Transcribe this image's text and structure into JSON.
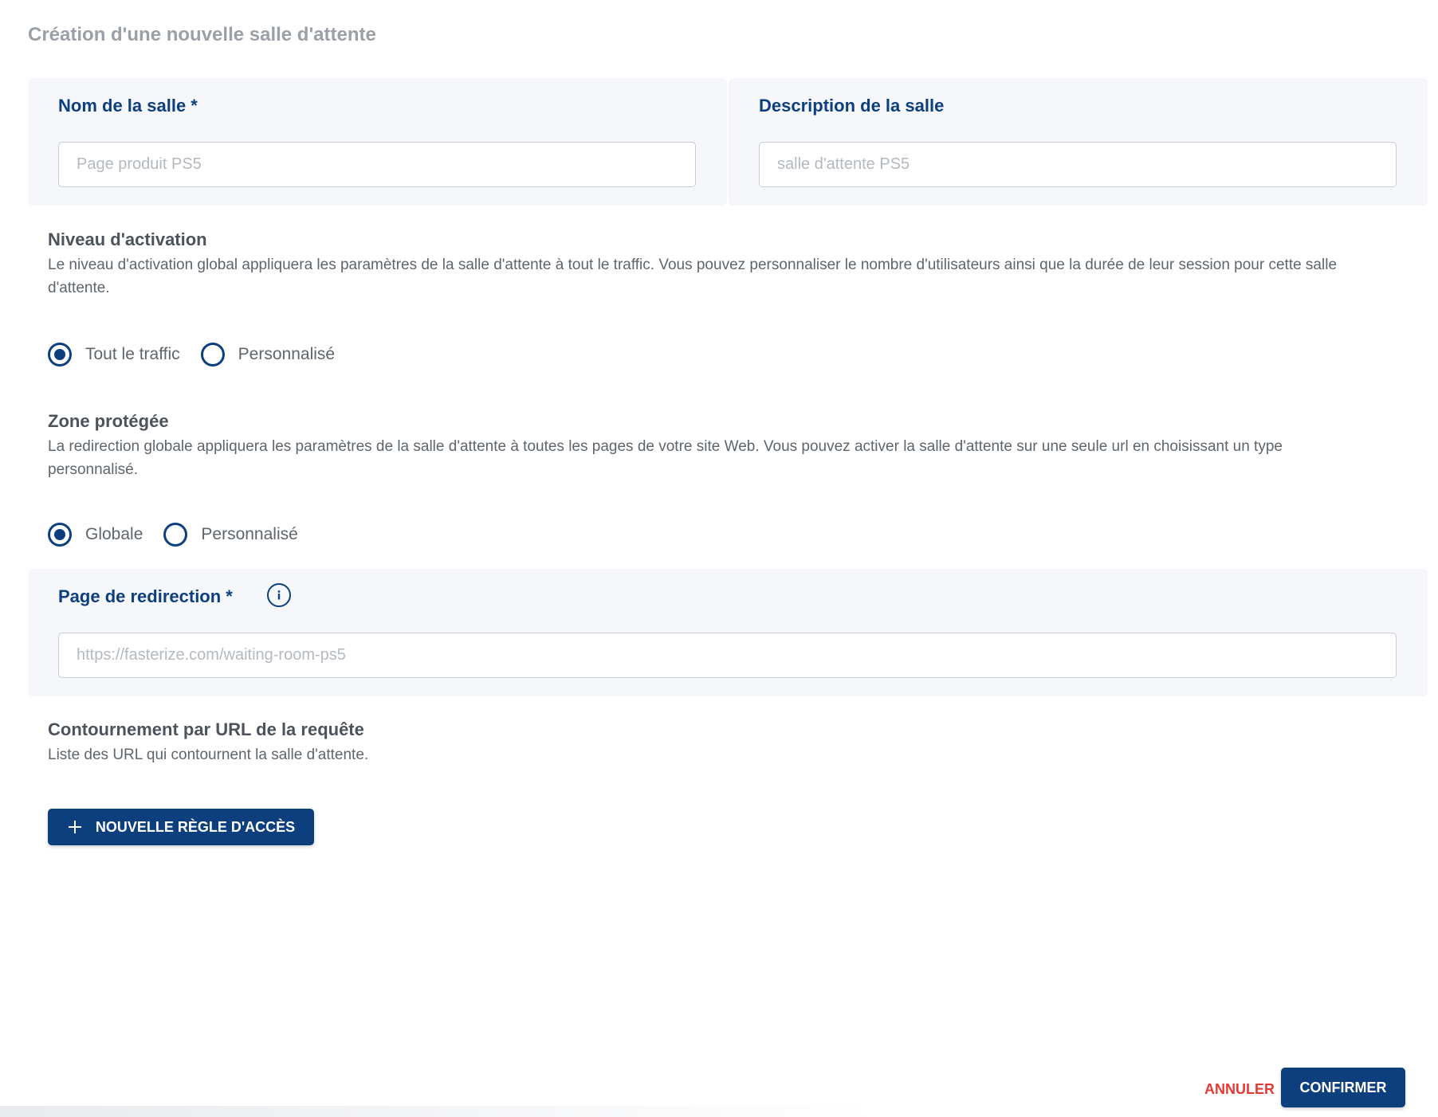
{
  "page": {
    "title": "Création d'une nouvelle salle d'attente"
  },
  "room_name": {
    "label": "Nom de la salle",
    "required_mark": "*",
    "placeholder": "Page produit PS5",
    "value": ""
  },
  "room_description": {
    "label": "Description de la salle",
    "placeholder": "salle d'attente PS5",
    "value": ""
  },
  "activation_level": {
    "title": "Niveau d'activation",
    "description": "Le niveau d'activation global appliquera les paramètres de la salle d'attente à tout le traffic. Vous pouvez personnaliser le nombre d'utilisateurs ainsi que la durée de leur session pour cette salle d'attente.",
    "options": [
      {
        "label": "Tout le traffic",
        "selected": true
      },
      {
        "label": "Personnalisé",
        "selected": false
      }
    ]
  },
  "protected_zone": {
    "title": "Zone protégée",
    "description": "La redirection globale appliquera les paramètres de la salle d'attente à toutes les pages de votre site Web. Vous pouvez activer la salle d'attente sur une seule url en choisissant un type personnalisé.",
    "options": [
      {
        "label": "Globale",
        "selected": true
      },
      {
        "label": "Personnalisé",
        "selected": false
      }
    ]
  },
  "redirect_page": {
    "label": "Page de redirection",
    "required_mark": "*",
    "placeholder": "https://fasterize.com/waiting-room-ps5",
    "value": ""
  },
  "bypass": {
    "title": "Contournement par URL de la requête",
    "description": "Liste des URL qui contournent la salle d'attente.",
    "add_rule_label": "NOUVELLE RÈGLE D'ACCÈS"
  },
  "footer": {
    "cancel_label": "ANNULER",
    "confirm_label": "CONFIRMER"
  },
  "colors": {
    "primary": "#0d3f7f",
    "danger": "#e53935",
    "panel_bg": "#f5f7fb"
  }
}
